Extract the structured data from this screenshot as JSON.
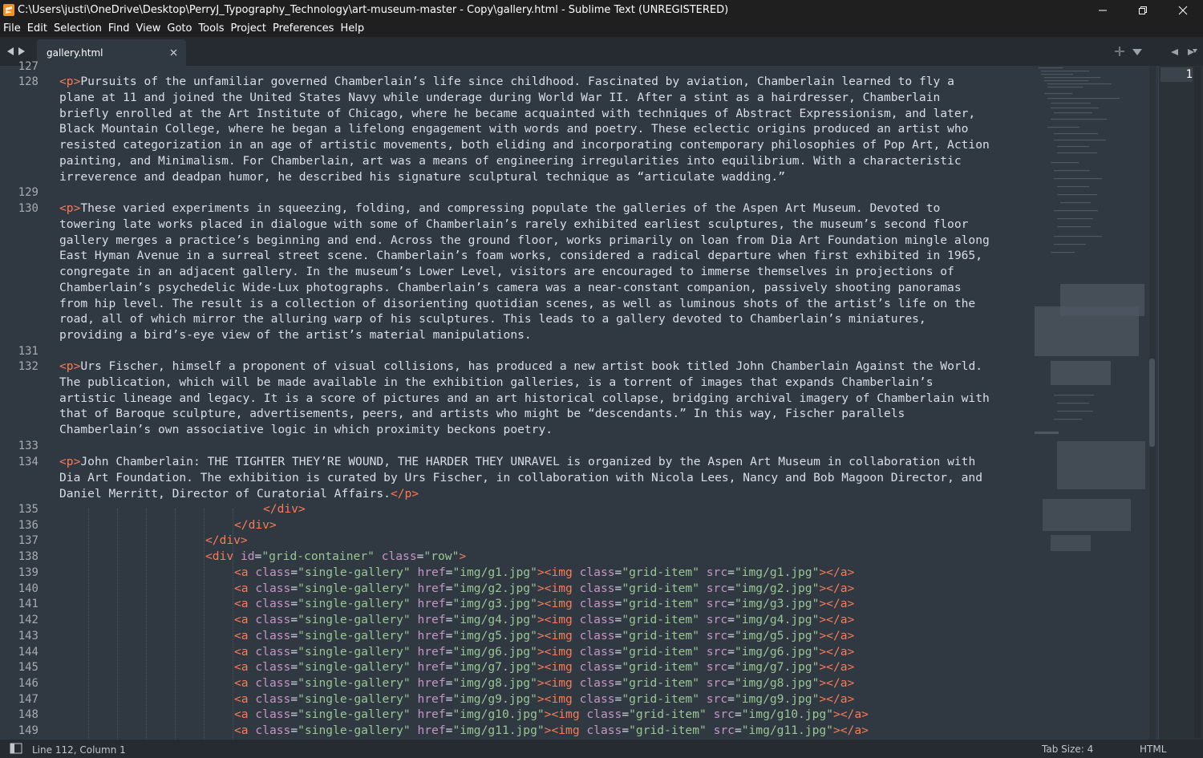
{
  "window": {
    "title": "C:\\Users\\justi\\OneDrive\\Desktop\\PerryJ_Typography_Technology\\art-museum-master - Copy\\gallery.html - Sublime Text (UNREGISTERED)",
    "app_icon": "sublime-text-icon",
    "controls": [
      "minimize-icon",
      "restore-icon",
      "close-icon"
    ]
  },
  "menu": [
    "File",
    "Edit",
    "Selection",
    "Find",
    "View",
    "Goto",
    "Tools",
    "Project",
    "Preferences",
    "Help"
  ],
  "tab": {
    "label": "gallery.html",
    "close_icon": "close-icon"
  },
  "editor": {
    "partial_line": "127",
    "gutter_numbers": [
      "128",
      "129",
      "130",
      "131",
      "132",
      "133",
      "134",
      "135",
      "136",
      "137",
      "138",
      "139",
      "140",
      "141",
      "142",
      "143",
      "144",
      "145",
      "146",
      "147",
      "148",
      "149"
    ],
    "paragraphs": {
      "p128": [
        "Pursuits of the unfamiliar governed Chamberlain’s life since childhood. Fascinated by aviation, Chamberlain learned to fly a",
        "plane at 11 and joined the United States Navy while underage during World War II. After a stint as a hairdresser, Chamberlain",
        "briefly enrolled at the Art Institute of Chicago, where he became acquainted with techniques of Abstract Expressionism, and later,",
        "Black Mountain College, where he began a lifelong engagement with words and poetry. These eclectic origins produced an artist who",
        "resisted categorization in an age of artistic movements, both eliding and incorporating contemporary philosophies of Pop Art, Action",
        "painting, and Minimalism. For Chamberlain, art was a means of engineering irregularities into equilibrium. With a characteristic",
        "irreverence and deadpan humor, he described his signature sculptural technique as “articulate wadding.”"
      ],
      "p130": [
        "These varied experiments in squeezing, folding, and compressing populate the galleries of the Aspen Art Museum. Devoted to",
        "towering late works placed in dialogue with some of Chamberlain’s rarely exhibited earliest sculptures, the museum’s second floor",
        "gallery merges a practice’s beginning and end. Across the ground floor, works primarily on loan from Dia Art Foundation mingle along",
        "East Hyman Avenue in a surreal street scene. Chamberlain’s foam works, considered a radical departure when first exhibited in 1965,",
        "congregate in an adjacent gallery. In the museum’s Lower Level, visitors are encouraged to immerse themselves in projections of",
        "Chamberlain’s psychedelic Wide-Lux photographs. Chamberlain’s camera was a near-constant companion, passively shooting panoramas",
        "from hip level. The result is a collection of disorienting quotidian scenes, as well as luminous shots of the artist’s life on the",
        "road, all of which mirror the alluring warp of his sculptures. This leads to a gallery devoted to Chamberlain’s miniatures,",
        "providing a bird’s-eye view of the artist’s material manipulations."
      ],
      "p132": [
        "Urs Fischer, himself a proponent of visual collisions, has produced a new artist book titled John Chamberlain Against the World.",
        "The publication, which will be made available in the exhibition galleries, is a torrent of images that expands Chamberlain’s",
        "artistic lineage and legacy. It is a score of pictures and an art historical collapse, bridging archival imagery of Chamberlain with",
        "that of Baroque sculpture, advertisements, peers, and artists who might be “descendants.” In this way, Fischer parallels",
        "Chamberlain’s own associative logic in which proximity beckons poetry."
      ],
      "p134": [
        "John Chamberlain: THE TIGHTER THEY’RE WOUND, THE HARDER THEY UNRAVEL is organized by the Aspen Art Museum in collaboration with",
        "Dia Art Foundation. The exhibition is curated by Urs Fischer, in collaboration with Nicola Lees, Nancy and Bob Magoon Director, and",
        "Daniel Merritt, Director of Curatorial Affairs."
      ]
    },
    "tokens": {
      "p_open": "<p>",
      "p_open_lt": "<",
      "p_name": "p",
      "p_gt": ">",
      "p_close": "</p>",
      "div_close": "</div>",
      "div_open_lt": "<",
      "div_name": "div",
      "id_attr": " id",
      "eq": "=",
      "grid_id": "\"grid-container\"",
      "class_attr": " class",
      "row_class": "\"row\"",
      "gt": ">",
      "a_lt": "<",
      "a_name": "a",
      "href_attr": " href",
      "img_lt": "><",
      "img_name": "img",
      "src_attr": " src",
      "a_close": "></a>",
      "single_gallery": "\"single-gallery\"",
      "grid_item": "\"grid-item\""
    },
    "gallery_items": [
      "\"img/g1.jpg\"",
      "\"img/g2.jpg\"",
      "\"img/g3.jpg\"",
      "\"img/g4.jpg\"",
      "\"img/g5.jpg\"",
      "\"img/g6.jpg\"",
      "\"img/g7.jpg\"",
      "\"img/g8.jpg\"",
      "\"img/g9.jpg\"",
      "\"img/g10.jpg\"",
      "\"img/g11.jpg\""
    ]
  },
  "second_pane": {
    "line_number": "1"
  },
  "status": {
    "position": "Line 112, Column 1",
    "tab_size": "Tab Size: 4",
    "syntax": "HTML",
    "panel_icon": "panel-toggle-icon"
  },
  "colors": {
    "background": "#303841",
    "tag": "#f97b58",
    "attribute": "#c695c6",
    "string": "#99c794",
    "text": "#d8dee9"
  }
}
